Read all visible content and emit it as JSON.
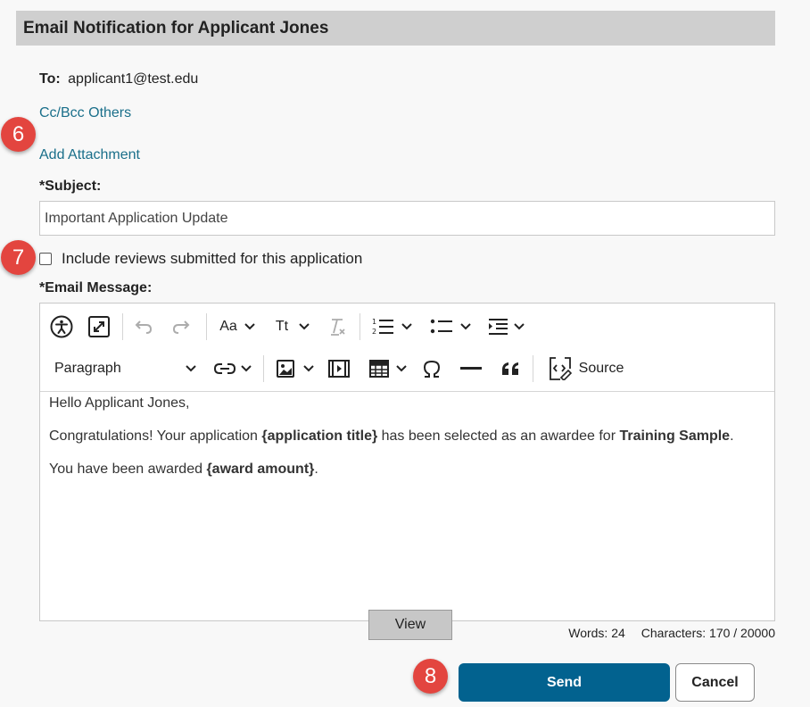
{
  "dialog": {
    "title": "Email Notification for Applicant Jones"
  },
  "recipient": {
    "label": "To:",
    "email": "applicant1@test.edu"
  },
  "links": {
    "cc_bcc": "Cc/Bcc Others",
    "add_attachment": "Add Attachment"
  },
  "subject": {
    "label": "*Subject:",
    "value": "Important Application Update"
  },
  "include_reviews": {
    "label": "Include reviews submitted for this application",
    "checked": false
  },
  "message": {
    "label": "*Email Message:",
    "toolbar": {
      "font_size": "Aa",
      "text_style": "Tt",
      "block_format": "Paragraph",
      "source_label": "Source"
    },
    "body": {
      "greeting": "Hello Applicant Jones,",
      "line2_prefix": "Congratulations! Your application ",
      "line2_token": "{application title}",
      "line2_middle": " has been selected as an awardee for ",
      "line2_program": "Training Sample",
      "line2_suffix": ".",
      "line3_prefix": "You have been awarded ",
      "line3_token": "{award amount}",
      "line3_suffix": ".",
      "view_button": "View"
    }
  },
  "counts": {
    "words": "Words: 24",
    "characters": "Characters: 170 / 20000"
  },
  "actions": {
    "send": "Send",
    "cancel": "Cancel"
  },
  "callouts": {
    "six": "6",
    "seven": "7",
    "eight": "8"
  },
  "colors": {
    "link": "#1a6f8a",
    "primary": "#02628f",
    "callout": "#e3453f",
    "title_bar": "#cfcfcf"
  }
}
